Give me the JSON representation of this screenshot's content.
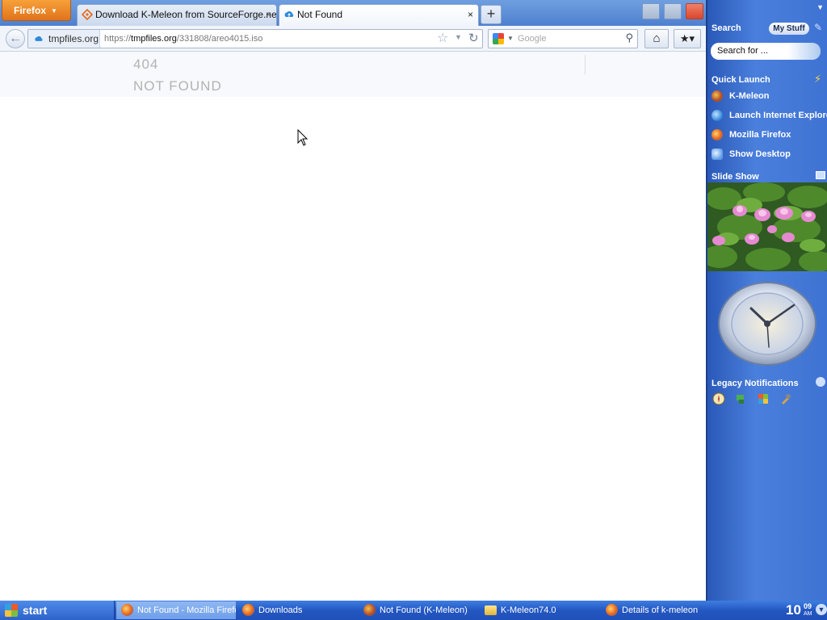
{
  "browser": {
    "app_button": "Firefox",
    "tabs": [
      {
        "title": "Download K-Meleon from SourceForge.net",
        "icon": "sourceforge-icon",
        "active": false
      },
      {
        "title": "Not Found",
        "icon": "cloud-icon",
        "active": true
      }
    ],
    "close_glyph": "×",
    "newtab_glyph": "+",
    "site_identity": "tmpfiles.org",
    "url_prefix": "https://",
    "url_domain": "tmpfiles.org",
    "url_path": "/331808/areo4015.iso",
    "search_placeholder": "Google",
    "page": {
      "code": "404",
      "message": "NOT FOUND"
    }
  },
  "sidebar": {
    "search_title": "Search",
    "my_stuff": "My Stuff",
    "search_placeholder": "Search for ...",
    "quick_launch_title": "Quick Launch",
    "quick_launch_items": [
      {
        "label": "K-Meleon",
        "icon": "k-meleon-icon"
      },
      {
        "label": "Launch Internet Explorer",
        "icon": "ie-icon"
      },
      {
        "label": "Mozilla Firefox",
        "icon": "firefox-icon"
      },
      {
        "label": "Show Desktop",
        "icon": "desktop-icon"
      }
    ],
    "slideshow_title": "Slide Show",
    "legacy_title": "Legacy Notifications"
  },
  "taskbar": {
    "start_label": "start",
    "tasks": [
      {
        "label": "Not Found - Mozilla Firefox",
        "icon": "firefox-icon",
        "active": true
      },
      {
        "label": "Downloads",
        "icon": "firefox-icon",
        "active": false
      },
      {
        "label": "Not Found (K-Meleon)",
        "icon": "k-meleon-icon",
        "active": false
      },
      {
        "label": "K-Meleon74.0",
        "icon": "folder-icon",
        "active": false
      },
      {
        "label": "Details of k-meleon",
        "icon": "firefox-icon",
        "active": false
      }
    ],
    "clock_hour": "10",
    "clock_minute": "09",
    "clock_ampm": "AM"
  },
  "colors": {
    "firefox_orange": "#e97a1f",
    "sidebar_blue": "#3f73d3",
    "taskbar_blue": "#2457c2",
    "close_red": "#d9472a"
  }
}
